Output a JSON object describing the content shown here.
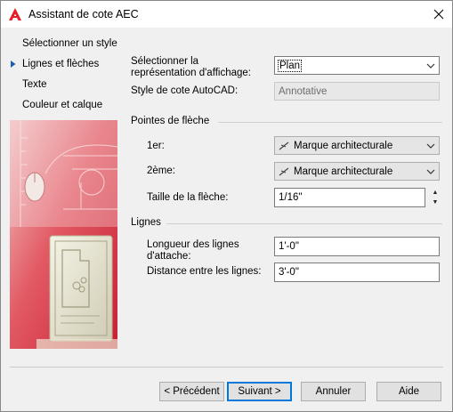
{
  "window": {
    "title": "Assistant de cote AEC",
    "close": "✕"
  },
  "nav": {
    "items": [
      {
        "label": "Sélectionner un style"
      },
      {
        "label": "Lignes et flèches"
      },
      {
        "label": "Texte"
      },
      {
        "label": "Couleur et calque"
      }
    ],
    "active_index": 1
  },
  "form": {
    "display_rep_label": "Sélectionner la représentation d'affichage:",
    "display_rep_value": "Plan",
    "autocad_style_label": "Style de cote AutoCAD:",
    "autocad_style_value": "Annotative",
    "arrowheads_group": "Pointes de flèche",
    "first_label": "1er:",
    "first_value": "Marque architecturale",
    "second_label": "2ème:",
    "second_value": "Marque architecturale",
    "arrow_size_label": "Taille de la flèche:",
    "arrow_size_value": "1/16\"",
    "lines_group": "Lignes",
    "extension_length_label": "Longueur des lignes d'attache:",
    "extension_length_value": "1'-0\"",
    "line_spacing_label": "Distance entre les lignes:",
    "line_spacing_value": "3'-0\""
  },
  "buttons": {
    "back": "< Précédent",
    "next": "Suivant >",
    "cancel": "Annuler",
    "help": "Aide"
  },
  "colors": {
    "accent": "#0078d7",
    "art_red": "#d8283a"
  }
}
